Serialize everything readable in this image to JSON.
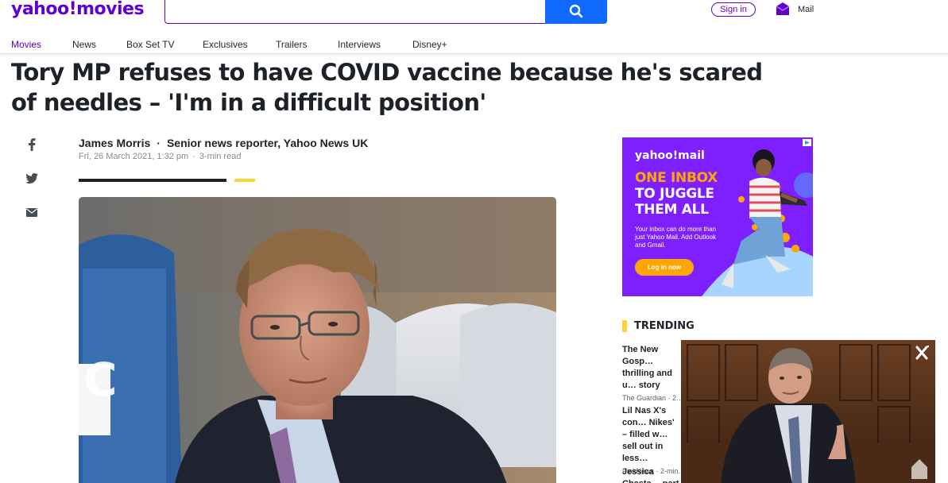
{
  "brand": {
    "logo_text": "yahoo!movies",
    "color": "#6001d2"
  },
  "search": {
    "value": "",
    "placeholder": ""
  },
  "header": {
    "signin_label": "Sign in",
    "mail_label": "Mail"
  },
  "nav": {
    "items": [
      {
        "label": "Movies",
        "active": true
      },
      {
        "label": "News"
      },
      {
        "label": "Box Set TV"
      },
      {
        "label": "Exclusives"
      },
      {
        "label": "Trailers"
      },
      {
        "label": "Interviews"
      },
      {
        "label": "Disney+"
      }
    ]
  },
  "article": {
    "headline": "Tory MP refuses to have COVID vaccine because he's scared of needles – 'I'm in a difficult position'",
    "author": "James Morris",
    "author_title": "Senior news reporter, Yahoo News UK",
    "date": "Fri, 26 March 2021, 1:32 pm",
    "read_time": "3-min read"
  },
  "share": {
    "icons": [
      "facebook-icon",
      "twitter-icon",
      "email-icon"
    ]
  },
  "ad": {
    "brand": "yahoo!mail",
    "headline_lines": [
      "ONE INBOX",
      "TO JUGGLE",
      "THEM ALL"
    ],
    "body": "Your inbox can do more than just Yahoo Mail. Add Outlook and Gmail.",
    "cta": "Log in now"
  },
  "trending": {
    "title": "TRENDING",
    "items": [
      {
        "headline": "The New Gosp… thrilling and u… story",
        "source": "The Guardian · 2…"
      },
      {
        "headline": "Lil Nas X's con… Nikes' – filled w… sell out in less…",
        "source": "PinkNews · 2-min…"
      },
      {
        "headline": "Jessica Chasta… part of Covid…",
        "source": ""
      }
    ]
  },
  "colors": {
    "accent": "#6001d2",
    "search_button": "#0f69ff",
    "trending_yellow": "#ffd333"
  }
}
